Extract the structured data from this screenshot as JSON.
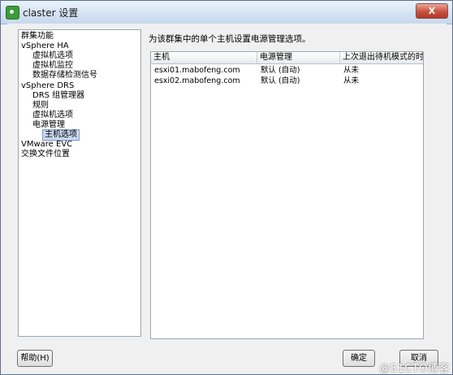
{
  "window": {
    "title": "claster 设置",
    "close_label": "X"
  },
  "sidebar": {
    "items": [
      {
        "label": "群集功能"
      },
      {
        "label": "vSphere HA"
      },
      {
        "label": "虚拟机选项"
      },
      {
        "label": "虚拟机监控"
      },
      {
        "label": "数据存储检测信号"
      },
      {
        "label": "vSphere DRS"
      },
      {
        "label": "DRS 组管理器"
      },
      {
        "label": "规则"
      },
      {
        "label": "虚拟机选项"
      },
      {
        "label": "电源管理"
      },
      {
        "label": "主机选项",
        "selected": true
      },
      {
        "label": "VMware EVC"
      },
      {
        "label": "交换文件位置"
      }
    ]
  },
  "main": {
    "heading": "为该群集中的单个主机设置电源管理选项。",
    "table": {
      "columns": [
        "主机",
        "电源管理",
        "上次退出待机模式的时间"
      ],
      "rows": [
        [
          "esxi01.mabofeng.com",
          "默认 (自动)",
          "从未"
        ],
        [
          "esxi02.mabofeng.com",
          "默认 (自动)",
          "从未"
        ]
      ]
    }
  },
  "footer": {
    "help_label": "帮助(H)",
    "ok_label": "确定",
    "cancel_label": "取消"
  },
  "watermark": "@51CTO博客"
}
